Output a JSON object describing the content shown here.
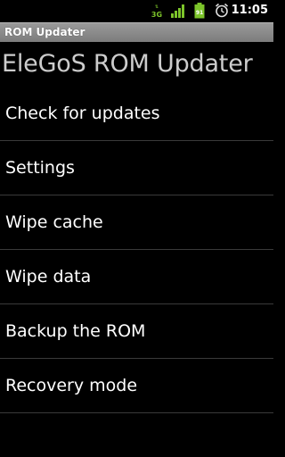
{
  "status_bar": {
    "network_label": "3G",
    "battery_level": "91",
    "time": "11:05",
    "icons": [
      "3g-data-icon",
      "signal-strength-icon",
      "battery-icon",
      "alarm-clock-icon"
    ]
  },
  "window": {
    "title": "ROM Updater"
  },
  "app": {
    "heading": "EleGoS ROM Updater"
  },
  "menu": {
    "items": [
      {
        "label": "Check for updates"
      },
      {
        "label": "Settings"
      },
      {
        "label": "Wipe cache"
      },
      {
        "label": "Wipe data"
      },
      {
        "label": "Backup the ROM"
      },
      {
        "label": "Recovery mode"
      }
    ]
  },
  "colors": {
    "background": "#000000",
    "title_bar": "#8a8a8a",
    "heading_text": "#cccccc",
    "divider": "#3a3a3a",
    "status_icons": "#7cc42a"
  }
}
